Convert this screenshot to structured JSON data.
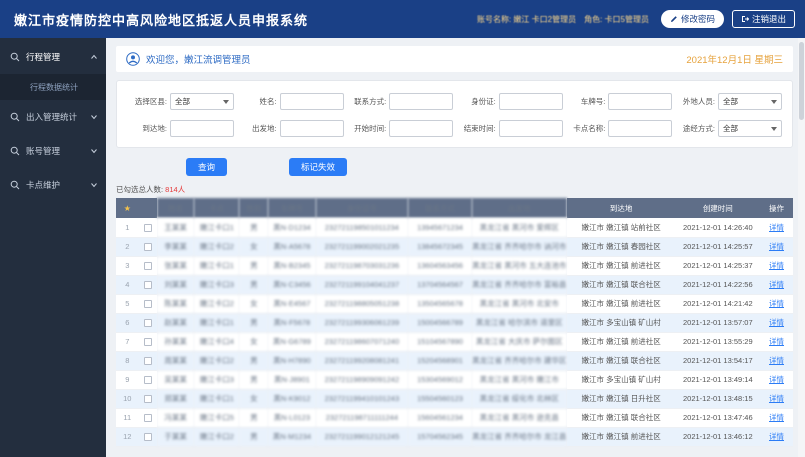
{
  "app": {
    "title": "嫩江市疫情防控中高风险地区抵返人员申报系统"
  },
  "header": {
    "account_info": "账号名称: 嫩江 卡口2管理员　角色: 卡口5管理员",
    "change_password_label": "修改密码",
    "logout_label": "注销退出"
  },
  "sidebar": {
    "items": [
      {
        "label": "行程管理"
      },
      {
        "label": "出入管理统计"
      },
      {
        "label": "账号管理"
      },
      {
        "label": "卡点维护"
      }
    ],
    "subitems": [
      {
        "label": "行程数据统计"
      }
    ]
  },
  "welcome": {
    "text": "欢迎您，嫩江流调管理员",
    "date": "2021年12月1日 星期三"
  },
  "filters": {
    "row1": [
      {
        "label": "选择区县:",
        "value": "全部"
      },
      {
        "label": "姓名:",
        "value": ""
      },
      {
        "label": "联系方式:",
        "value": ""
      },
      {
        "label": "身份证:",
        "value": ""
      },
      {
        "label": "车牌号:",
        "value": ""
      },
      {
        "label": "外地人员:",
        "value": "全部"
      }
    ],
    "row2": [
      {
        "label": "到达地:",
        "value": ""
      },
      {
        "label": "出发地:",
        "value": ""
      },
      {
        "label": "开始时间:",
        "value": ""
      },
      {
        "label": "结束时间:",
        "value": ""
      },
      {
        "label": "卡点名称:",
        "value": ""
      },
      {
        "label": "途经方式:",
        "value": "全部"
      }
    ]
  },
  "toolbar": {
    "query_label": "查询",
    "mark_invalid_label": "标记失效"
  },
  "summary": {
    "prefix": "已勾选总人数: ",
    "count": "814人"
  },
  "table": {
    "columns": [
      "姓名",
      "卡点",
      "性别",
      "车牌号",
      "身份证号",
      "联系方式",
      "出发地",
      "到达地",
      "创建时间",
      "操作"
    ],
    "rows": [
      {
        "num": "1",
        "name": "王某某",
        "checkpoint": "嫩江卡口1",
        "gender": "男",
        "plate": "黑N·D1234",
        "id_no": "232721198501011234",
        "phone": "13945671234",
        "origin": "黑龙江省 黑河市 爱辉区",
        "dest": "嫩江市 嫩江镇 站前社区",
        "time": "2021-12-01 14:26:40",
        "action": "详情"
      },
      {
        "num": "2",
        "name": "李某某",
        "checkpoint": "嫩江卡口2",
        "gender": "女",
        "plate": "黑N·A5678",
        "id_no": "232721199002021235",
        "phone": "13845672345",
        "origin": "黑龙江省 齐齐哈尔市 讷河市",
        "dest": "嫩江市 嫩江镇 春园社区",
        "time": "2021-12-01 14:25:57",
        "action": "详情"
      },
      {
        "num": "3",
        "name": "张某某",
        "checkpoint": "嫩江卡口1",
        "gender": "男",
        "plate": "黑N·B2345",
        "id_no": "232721198703031236",
        "phone": "13604563456",
        "origin": "黑龙江省 黑河市 五大连池市",
        "dest": "嫩江市 嫩江镇 前进社区",
        "time": "2021-12-01 14:25:37",
        "action": "详情"
      },
      {
        "num": "4",
        "name": "刘某某",
        "checkpoint": "嫩江卡口3",
        "gender": "男",
        "plate": "黑N·C3456",
        "id_no": "232721199104041237",
        "phone": "13704564567",
        "origin": "黑龙江省 齐齐哈尔市 富裕县",
        "dest": "嫩江市 嫩江镇 联合社区",
        "time": "2021-12-01 14:22:56",
        "action": "详情"
      },
      {
        "num": "5",
        "name": "陈某某",
        "checkpoint": "嫩江卡口2",
        "gender": "女",
        "plate": "黑N·E4567",
        "id_no": "232721198805051238",
        "phone": "13504565678",
        "origin": "黑龙江省 黑河市 北安市",
        "dest": "嫩江市 嫩江镇 前进社区",
        "time": "2021-12-01 14:21:42",
        "action": "详情"
      },
      {
        "num": "6",
        "name": "赵某某",
        "checkpoint": "嫩江卡口1",
        "gender": "男",
        "plate": "黑N·F5678",
        "id_no": "232721199306061239",
        "phone": "15004566789",
        "origin": "黑龙江省 哈尔滨市 道里区",
        "dest": "嫩江市 多宝山镇 矿山村",
        "time": "2021-12-01 13:57:07",
        "action": "详情"
      },
      {
        "num": "7",
        "name": "孙某某",
        "checkpoint": "嫩江卡口4",
        "gender": "女",
        "plate": "黑N·G6789",
        "id_no": "232721198607071240",
        "phone": "15104567890",
        "origin": "黑龙江省 大庆市 萨尔图区",
        "dest": "嫩江市 嫩江镇 前进社区",
        "time": "2021-12-01 13:55:29",
        "action": "详情"
      },
      {
        "num": "8",
        "name": "周某某",
        "checkpoint": "嫩江卡口2",
        "gender": "男",
        "plate": "黑N·H7890",
        "id_no": "232721199208081241",
        "phone": "15204568901",
        "origin": "黑龙江省 齐齐哈尔市 建华区",
        "dest": "嫩江市 嫩江镇 联合社区",
        "time": "2021-12-01 13:54:17",
        "action": "详情"
      },
      {
        "num": "9",
        "name": "吴某某",
        "checkpoint": "嫩江卡口3",
        "gender": "男",
        "plate": "黑N·J8901",
        "id_no": "232721198909091242",
        "phone": "15304569012",
        "origin": "黑龙江省 黑河市 嫩江市",
        "dest": "嫩江市 多宝山镇 矿山村",
        "time": "2021-12-01 13:49:14",
        "action": "详情"
      },
      {
        "num": "10",
        "name": "郑某某",
        "checkpoint": "嫩江卡口1",
        "gender": "女",
        "plate": "黑N·K9012",
        "id_no": "232721199410101243",
        "phone": "15504560123",
        "origin": "黑龙江省 绥化市 北林区",
        "dest": "嫩江市 嫩江镇 日升社区",
        "time": "2021-12-01 13:48:15",
        "action": "详情"
      },
      {
        "num": "11",
        "name": "冯某某",
        "checkpoint": "嫩江卡口5",
        "gender": "男",
        "plate": "黑N·L0123",
        "id_no": "232721198711111244",
        "phone": "15604561234",
        "origin": "黑龙江省 黑河市 逊克县",
        "dest": "嫩江市 嫩江镇 联合社区",
        "time": "2021-12-01 13:47:46",
        "action": "详情"
      },
      {
        "num": "12",
        "name": "于某某",
        "checkpoint": "嫩江卡口2",
        "gender": "男",
        "plate": "黑N·M1234",
        "id_no": "232721199012121245",
        "phone": "15704562345",
        "origin": "黑龙江省 齐齐哈尔市 龙江县",
        "dest": "嫩江市 嫩江镇 前进社区",
        "time": "2021-12-01 13:46:12",
        "action": "详情"
      }
    ]
  }
}
